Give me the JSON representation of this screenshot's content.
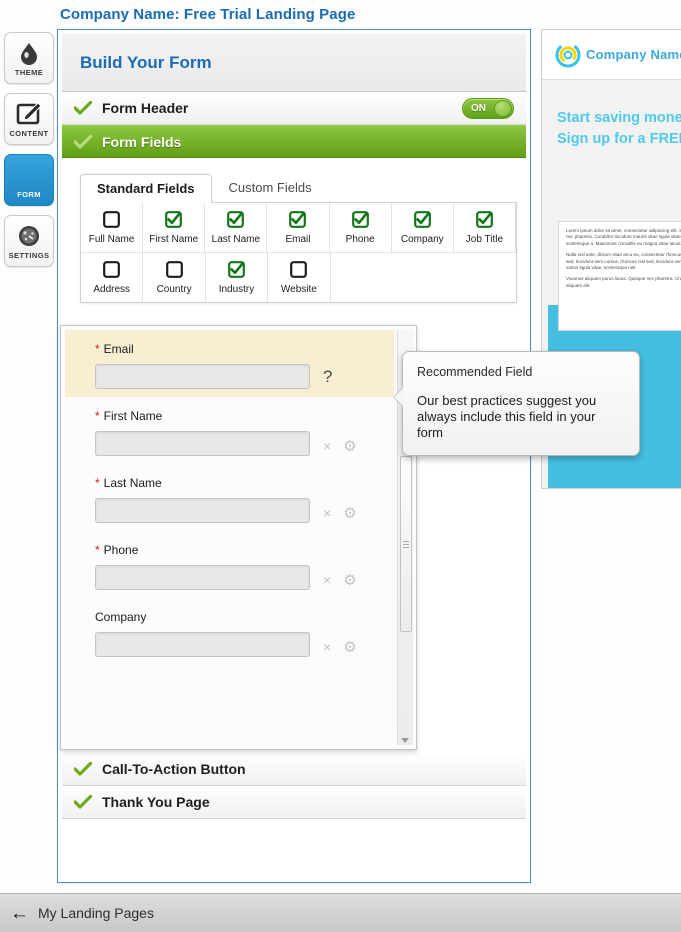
{
  "page_title": "Company Name: Free Trial Landing Page",
  "rail": {
    "items": [
      {
        "label": "THEME",
        "icon": "droplet-icon",
        "active": false
      },
      {
        "label": "CONTENT",
        "icon": "pencil-edit-icon",
        "active": false
      },
      {
        "label": "FORM",
        "icon": "form-lines-icon",
        "active": true
      },
      {
        "label": "SETTINGS",
        "icon": "gauge-icon",
        "active": false
      }
    ]
  },
  "builder": {
    "title": "Build Your Form",
    "sections": [
      {
        "label": "Form Header",
        "checked": true,
        "toggle": "ON"
      },
      {
        "label": "Form Fields",
        "checked": true,
        "active": true
      },
      {
        "label": "Call-To-Action Button",
        "checked": true
      },
      {
        "label": "Thank You Page",
        "checked": true
      }
    ],
    "toggle_on_label": "ON"
  },
  "field_picker": {
    "tabs": [
      {
        "label": "Standard Fields",
        "active": true
      },
      {
        "label": "Custom Fields",
        "active": false
      }
    ],
    "rows": [
      [
        {
          "label": "Full Name",
          "checked": false
        },
        {
          "label": "First Name",
          "checked": true
        },
        {
          "label": "Last Name",
          "checked": true
        },
        {
          "label": "Email",
          "checked": true
        },
        {
          "label": "Phone",
          "checked": true
        },
        {
          "label": "Company",
          "checked": true
        },
        {
          "label": "Job Title",
          "checked": true
        }
      ],
      [
        {
          "label": "Address",
          "checked": false
        },
        {
          "label": "Country",
          "checked": false
        },
        {
          "label": "Industry",
          "checked": true
        },
        {
          "label": "Website",
          "checked": false
        }
      ]
    ]
  },
  "form_preview": {
    "fields": [
      {
        "label": "Email",
        "required": true,
        "highlighted": true,
        "value": "",
        "help": "?"
      },
      {
        "label": "First Name",
        "required": true,
        "highlighted": false,
        "value": ""
      },
      {
        "label": "Last Name",
        "required": true,
        "highlighted": false,
        "value": ""
      },
      {
        "label": "Phone",
        "required": true,
        "highlighted": false,
        "value": ""
      },
      {
        "label": "Company",
        "required": false,
        "highlighted": false,
        "value": ""
      }
    ],
    "remove_icon": "×",
    "settings_icon": "⚙"
  },
  "tooltip": {
    "title": "Recommended Field",
    "body": "Our best practices suggest you always include this field in your form"
  },
  "preview_panel": {
    "brand": "Company Name",
    "headline_line1": "Start saving money",
    "headline_line2": "Sign up for a FREE",
    "paragraphs": [
      "Lorem ipsum dolor sit amet, consectetur adipiscing elit. Sed tortor nec pharetra. Curabitur tincidunt mauris vitae ligula vitae, scelerisque a. Maecenas convallis eu magna vitae lacus.",
      "Nulla nisl ante, dictum vitae arcu eu, consectetur rhoncus nisl sed, tincidunt sem cursus, rhoncus nisl sed, tincidunt sem cursus varius ligula vitae, scelerisque nisl.",
      "Vivamus aliquam purus lacus. Quisque nec pharetra. Cras ut aliquam elit."
    ]
  },
  "footer": {
    "back_icon": "←",
    "label": "My Landing Pages"
  },
  "colors": {
    "title_blue": "#1b6cb3",
    "accent_green": "#6aab1c",
    "active_blue": "#2189c8",
    "cyan": "#44bfe0",
    "highlight_cream": "#f8efd2"
  }
}
